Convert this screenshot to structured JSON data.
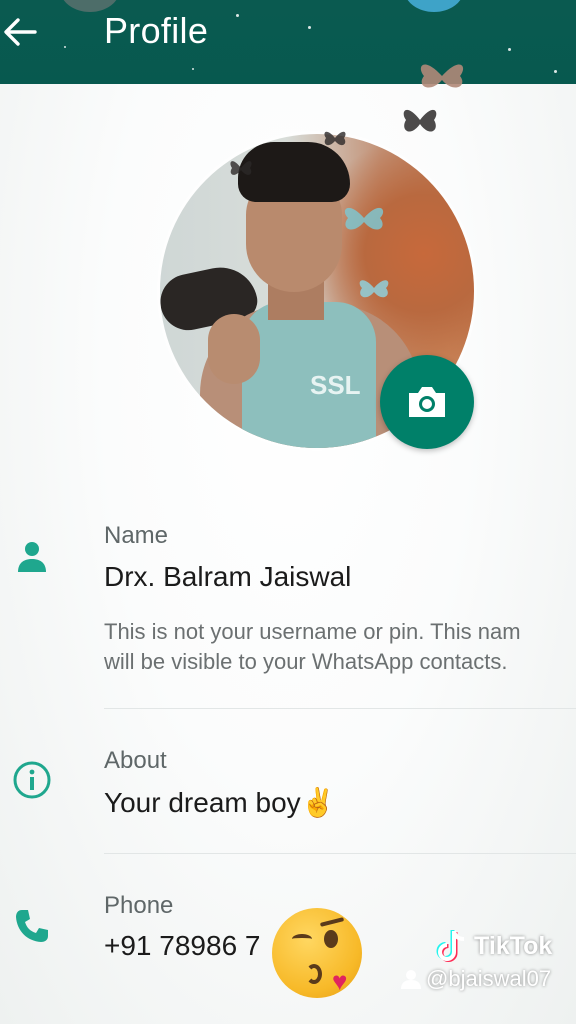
{
  "header": {
    "title": "Profile",
    "back_icon": "arrow-left-icon",
    "background": "#075e54"
  },
  "avatar": {
    "vest_print": "SSL",
    "camera_icon": "camera-icon",
    "accent": "#008069"
  },
  "rows": {
    "name": {
      "icon": "person-icon",
      "label": "Name",
      "value": "Drx. Balram Jaiswal",
      "hint_line1": "This is not your username or pin. This nam",
      "hint_line2": "will be visible to your WhatsApp contacts."
    },
    "about": {
      "icon": "info-icon",
      "label": "About",
      "value": "Your dream boy",
      "emoji": "✌"
    },
    "phone": {
      "icon": "phone-icon",
      "label": "Phone",
      "value": "+91 78986 7"
    }
  },
  "overlay": {
    "emoji_icon": "kissing-face-emoji-icon",
    "tiktok_label": "TikTok",
    "tiktok_handle": "@bjaiswal07",
    "tiktok_icon": "tiktok-note-icon",
    "user_icon": "user-icon"
  }
}
